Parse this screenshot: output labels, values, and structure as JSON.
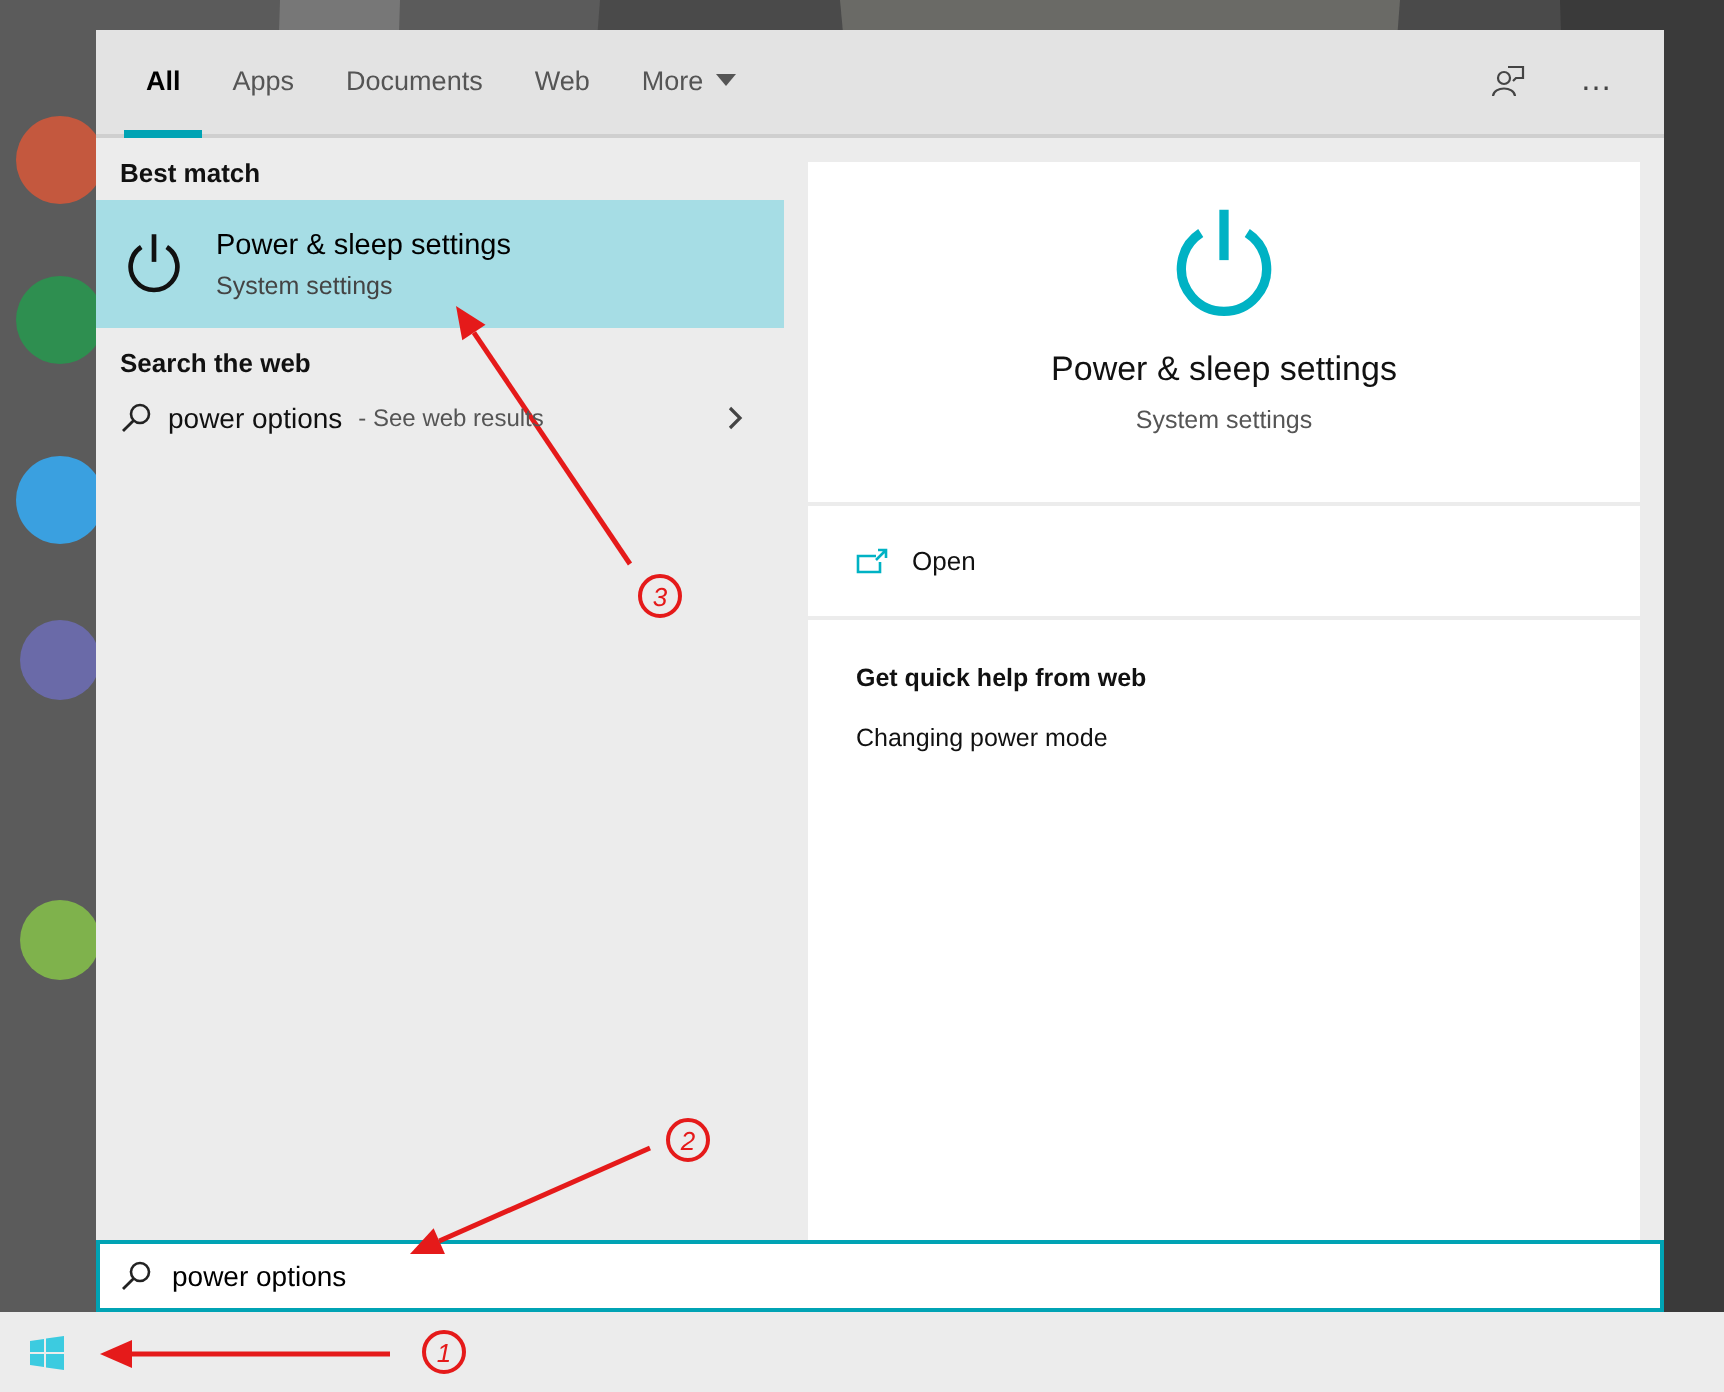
{
  "tabs": [
    {
      "label": "All",
      "selected": true
    },
    {
      "label": "Apps",
      "selected": false
    },
    {
      "label": "Documents",
      "selected": false
    },
    {
      "label": "Web",
      "selected": false
    },
    {
      "label": "More",
      "selected": false,
      "kind": "dropdown"
    }
  ],
  "header_actions": [
    "…"
  ],
  "best_match": {
    "heading": "Best match",
    "result": {
      "title": "Power & sleep settings",
      "subtitle": "System settings",
      "selected": true
    }
  },
  "web_search": {
    "heading": "Search the web",
    "query": "power options",
    "suffix": " - See web results"
  },
  "preview": {
    "title": "Power & sleep settings",
    "subtitle": "System settings",
    "actions": [
      {
        "label": "Open"
      }
    ],
    "help_heading": "Get quick help from web",
    "help_links": [
      "Changing power mode"
    ]
  },
  "search_box": {
    "value": "power options"
  },
  "annotations": [
    {
      "label": "1"
    },
    {
      "label": "2"
    },
    {
      "label": "3"
    }
  ]
}
